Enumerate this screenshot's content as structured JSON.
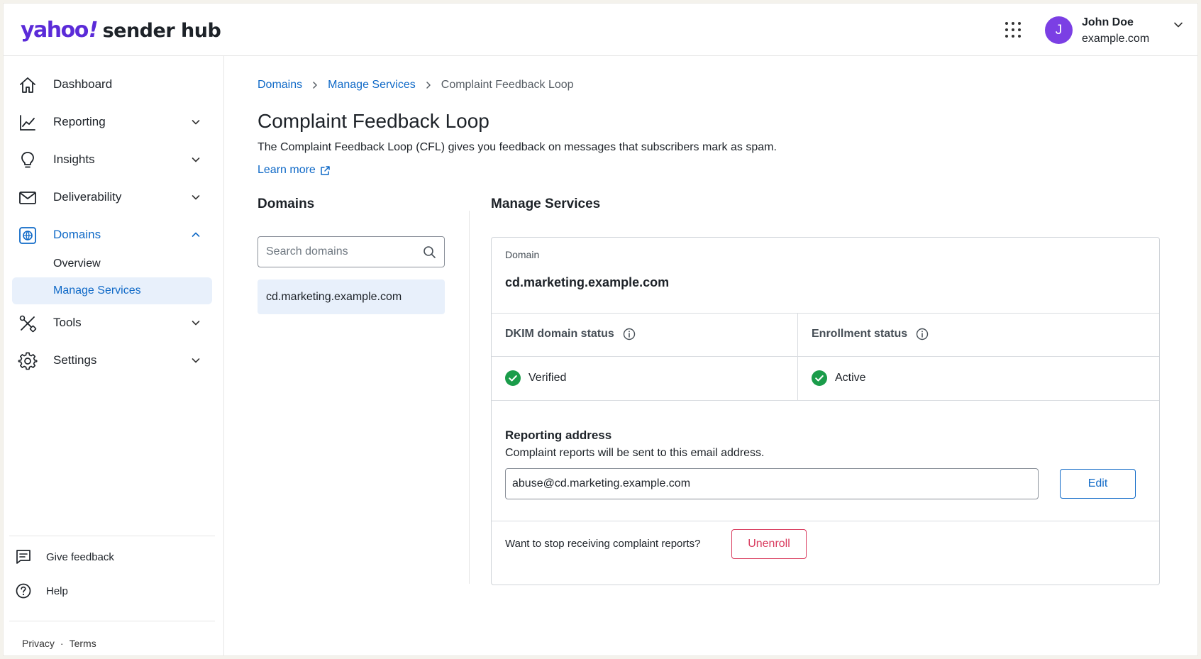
{
  "header": {
    "logo_yahoo": "yahoo",
    "logo_bang": "!",
    "logo_product": "sender hub",
    "apps_icon": "apps-grid-icon",
    "user": {
      "initial": "J",
      "name": "John Doe",
      "org": "example.com"
    }
  },
  "sidebar": {
    "items": [
      {
        "label": "Dashboard",
        "icon": "home-icon"
      },
      {
        "label": "Reporting",
        "icon": "chart-icon"
      },
      {
        "label": "Insights",
        "icon": "lightbulb-icon"
      },
      {
        "label": "Deliverability",
        "icon": "mail-icon"
      },
      {
        "label": "Domains",
        "icon": "domains-icon"
      },
      {
        "label": "Tools",
        "icon": "tools-icon"
      },
      {
        "label": "Settings",
        "icon": "gear-icon"
      }
    ],
    "domains_sub": [
      {
        "label": "Overview"
      },
      {
        "label": "Manage Services"
      }
    ],
    "footer": {
      "feedback": "Give feedback",
      "help": "Help",
      "privacy": "Privacy",
      "separator": "·",
      "terms": "Terms"
    }
  },
  "main": {
    "breadcrumb": [
      "Domains",
      "Manage Services",
      "Complaint Feedback Loop"
    ],
    "title": "Complaint Feedback Loop",
    "description": "The Complaint Feedback Loop (CFL) gives you feedback on messages that subscribers mark as spam.",
    "learn_more": "Learn more",
    "domains_panel": {
      "heading": "Domains",
      "search_placeholder": "Search domains",
      "items": [
        "cd.marketing.example.com"
      ]
    },
    "manage_panel": {
      "heading": "Manage Services",
      "domain_label": "Domain",
      "domain_value": "cd.marketing.example.com",
      "dkim_label": "DKIM domain status",
      "dkim_value": "Verified",
      "enrollment_label": "Enrollment status",
      "enrollment_value": "Active",
      "reporting_title": "Reporting address",
      "reporting_desc": "Complaint reports will be sent to this email address.",
      "reporting_email": "abuse@cd.marketing.example.com",
      "edit_label": "Edit",
      "unenroll_prompt": "Want to stop receiving complaint reports?",
      "unenroll_label": "Unenroll"
    }
  },
  "colors": {
    "brand_purple": "#5b2bd8",
    "link_blue": "#0f69c7",
    "success_green": "#1a9c4a",
    "danger_red": "#d93b5e",
    "selected_bg": "#e8f0fb"
  }
}
